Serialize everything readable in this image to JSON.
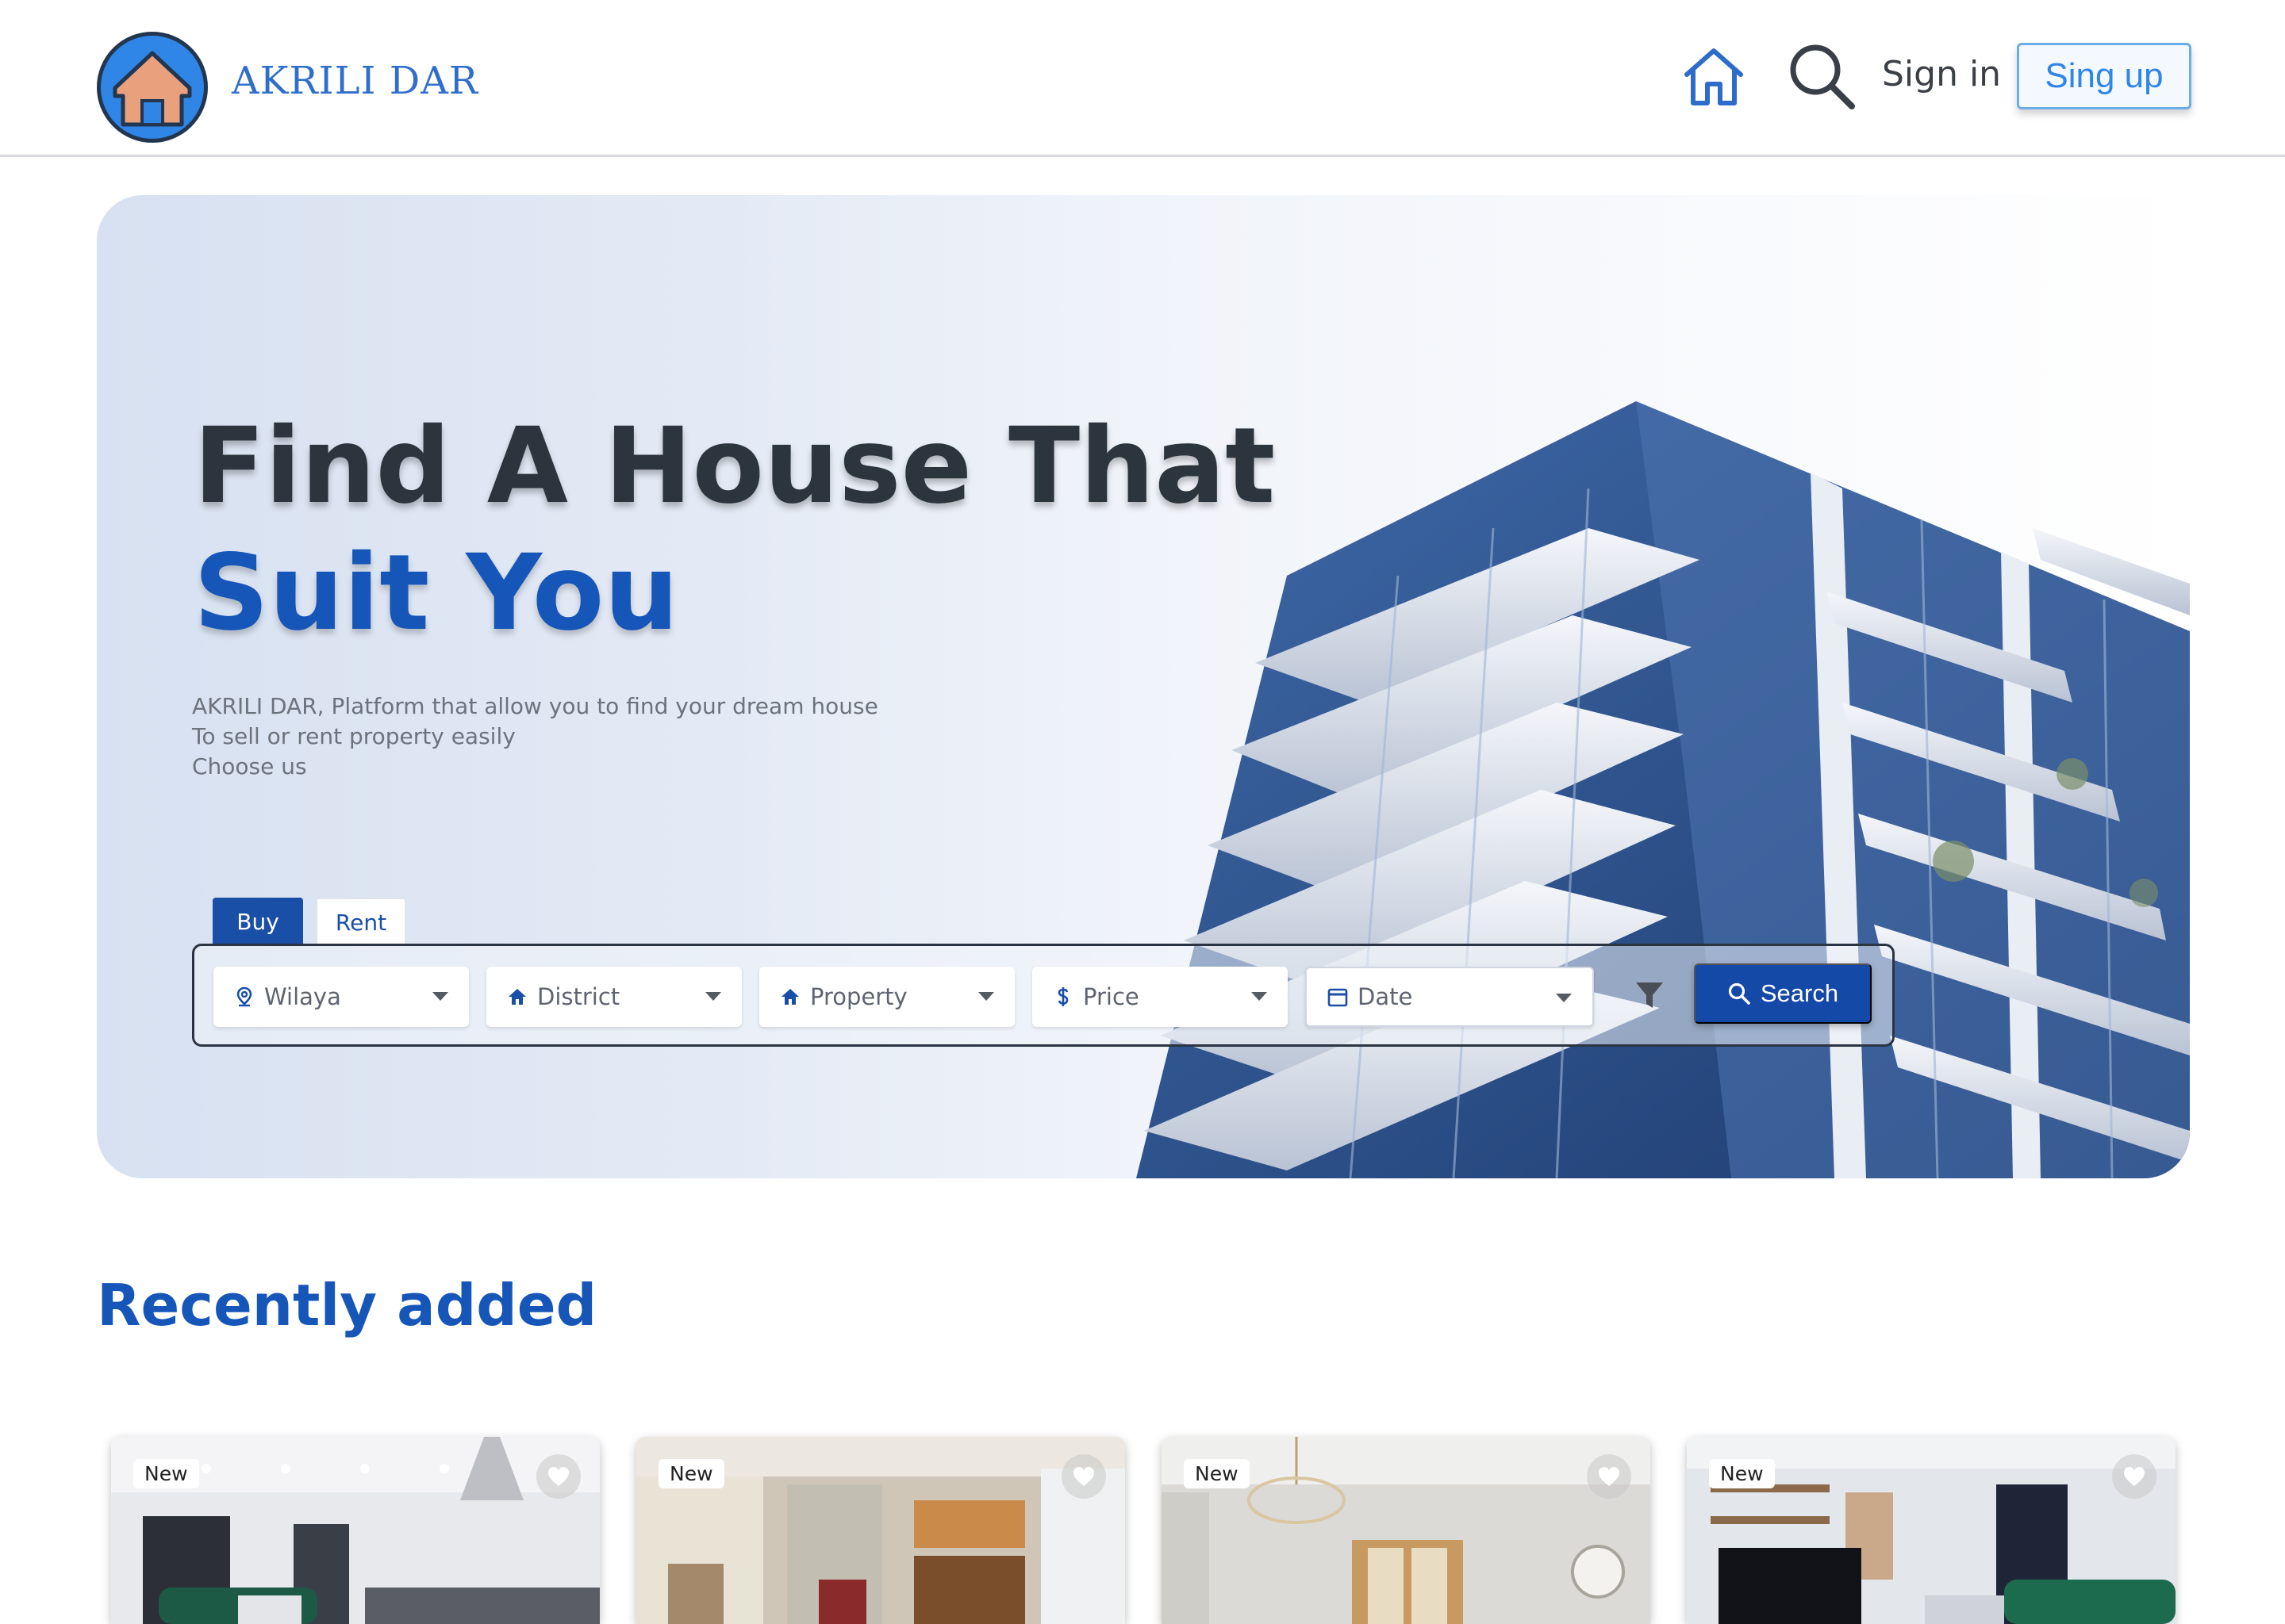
{
  "navbar": {
    "brand": "AKRILI DAR",
    "sign_in": "Sign in",
    "sign_up": "Sing up",
    "icons": [
      "house-logo-icon",
      "home-icon",
      "search-icon"
    ]
  },
  "hero": {
    "title_line1": "Find A House That",
    "title_line2": "Suit You",
    "description": [
      "AKRILI DAR, Platform that allow you to find your dream house",
      "To sell or rent property easily",
      "Choose us"
    ],
    "tabs": [
      {
        "label": "Buy",
        "active": true
      },
      {
        "label": "Rent",
        "active": false
      }
    ],
    "search": {
      "fields": [
        {
          "label": "Wilaya",
          "icon": "location-pin-icon"
        },
        {
          "label": "District",
          "icon": "home-small-icon"
        },
        {
          "label": "Property",
          "icon": "home-small-icon"
        },
        {
          "label": "Price",
          "icon": "dollar-icon"
        },
        {
          "label": "Date",
          "icon": "calendar-icon"
        }
      ],
      "filter_icon": "filter-icon",
      "button_label": "Search"
    }
  },
  "recent": {
    "title": "Recently added",
    "cards": [
      {
        "badge": "New",
        "favorite_icon": "heart-icon"
      },
      {
        "badge": "New",
        "favorite_icon": "heart-icon"
      },
      {
        "badge": "New",
        "favorite_icon": "heart-icon"
      },
      {
        "badge": "New",
        "favorite_icon": "heart-icon"
      }
    ]
  },
  "colors": {
    "primary": "#1656b9",
    "button": "#1449a8",
    "heading_dark": "#2c343d",
    "brand_blue": "#2f6ecb",
    "logo_bg": "#2f86e6",
    "logo_house": "#e9a07c"
  }
}
